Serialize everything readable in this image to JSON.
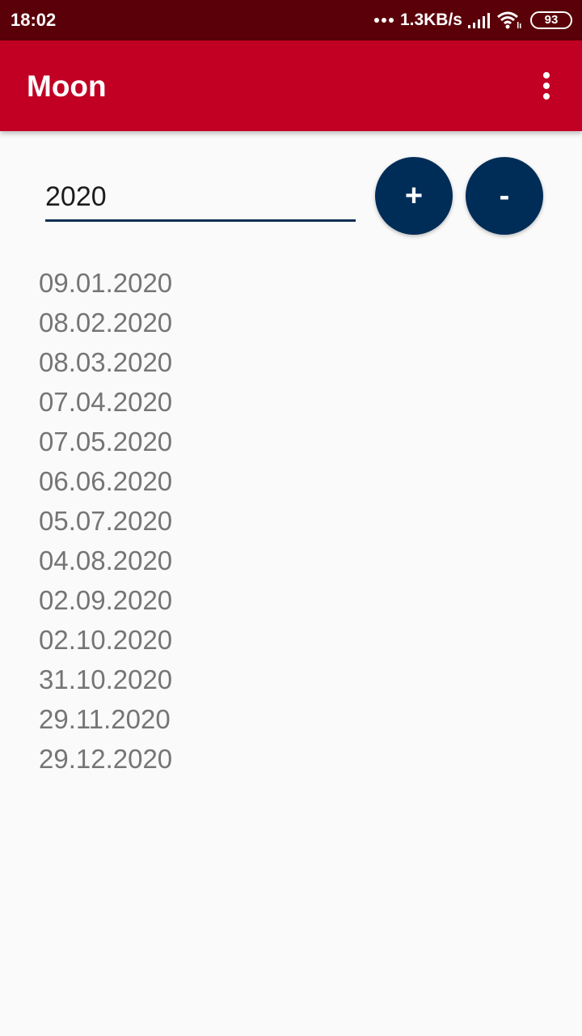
{
  "status_bar": {
    "time": "18:02",
    "net_speed": "1.3KB/s",
    "battery": "93"
  },
  "app_bar": {
    "title": "Moon"
  },
  "year_input": {
    "value": "2020"
  },
  "buttons": {
    "plus_label": "+",
    "minus_label": "-"
  },
  "dates": [
    "09.01.2020",
    "08.02.2020",
    "08.03.2020",
    "07.04.2020",
    "07.05.2020",
    "06.06.2020",
    "05.07.2020",
    "04.08.2020",
    "02.09.2020",
    "02.10.2020",
    "31.10.2020",
    "29.11.2020",
    "29.12.2020"
  ],
  "colors": {
    "status_bar": "#5a0008",
    "app_bar": "#c10024",
    "button": "#002d57",
    "list_text": "#757575"
  },
  "icons": {
    "signal": "signal-icon",
    "wifi": "wifi-icon",
    "battery": "battery-icon",
    "menu": "overflow-menu-icon"
  }
}
